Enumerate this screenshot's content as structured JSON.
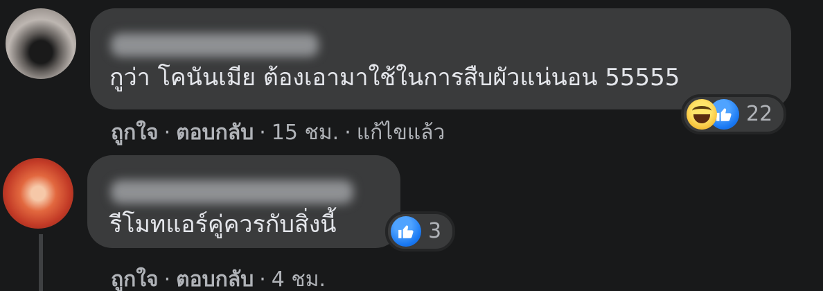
{
  "comments": [
    {
      "text": "กูว่า โคนันเมีย ต้องเอามาใช้ในการสืบผัวแน่นอน 55555",
      "reaction_count": "22",
      "reactions": [
        "haha-icon",
        "like-icon"
      ],
      "actions": {
        "like": "ถูกใจ",
        "reply": "ตอบกลับ",
        "time": "15 ชม.",
        "edited": "แก้ไขแล้ว"
      }
    },
    {
      "text": "รีโมทแอร์คู่ควรกับสิ่งนี้",
      "reaction_count": "3",
      "reactions": [
        "like-icon"
      ],
      "actions": {
        "like": "ถูกใจ",
        "reply": "ตอบกลับ",
        "time": "4 ชม."
      }
    }
  ],
  "separator": "·",
  "colors": {
    "background": "#18191a",
    "bubble": "#3a3b3c",
    "text": "#e4e6eb",
    "secondary_text": "#b0b3b8",
    "like_blue": "#1877f2",
    "haha_yellow": "#f7c13a"
  }
}
